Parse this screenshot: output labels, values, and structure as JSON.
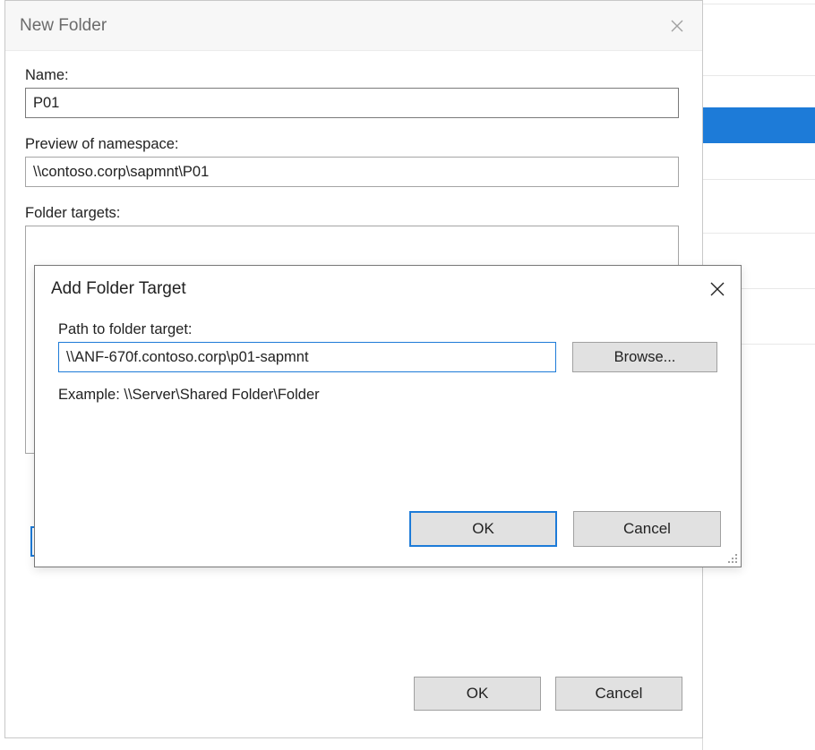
{
  "newFolder": {
    "title": "New Folder",
    "nameLabel": "Name:",
    "nameValue": "P01",
    "previewLabel": "Preview of namespace:",
    "previewValue": "\\\\contoso.corp\\sapmnt\\P01",
    "targetsLabel": "Folder targets:",
    "okLabel": "OK",
    "cancelLabel": "Cancel"
  },
  "addTarget": {
    "title": "Add Folder Target",
    "pathLabel": "Path to folder target:",
    "pathValue": "\\\\ANF-670f.contoso.corp\\p01-sapmnt",
    "browseLabel": "Browse...",
    "exampleLabel": "Example: \\\\Server\\Shared Folder\\Folder",
    "okLabel": "OK",
    "cancelLabel": "Cancel"
  }
}
